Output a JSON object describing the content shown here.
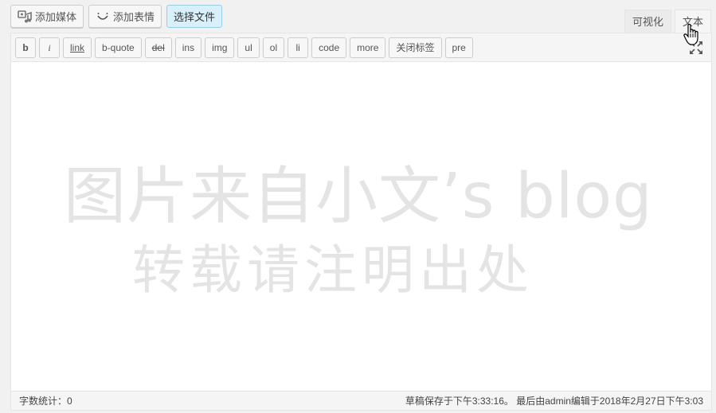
{
  "media_bar": {
    "add_media": "添加媒体",
    "add_emoji": "添加表情",
    "choose_file": "选择文件"
  },
  "tabs": [
    {
      "label": "可视化",
      "active": false
    },
    {
      "label": "文本",
      "active": true
    }
  ],
  "quicktags": [
    "b",
    "i",
    "link",
    "b-quote",
    "del",
    "ins",
    "img",
    "ul",
    "ol",
    "li",
    "code",
    "more",
    "关闭标签",
    "pre"
  ],
  "icons": {
    "add_media": "media-icon",
    "add_emoji": "smile-icon",
    "fullscreen": "fullscreen-icon",
    "cursor": "hand-cursor-icon"
  },
  "editor": {
    "content": "",
    "watermark_line1": "图片来自小文’s blog",
    "watermark_line2": "转载请注明出处"
  },
  "status": {
    "word_count": "字数统计：0",
    "draft_info": "草稿保存于下午3:33:16。 最后由admin编辑于2018年2月27日下午3:03"
  },
  "colors": {
    "choose_file_bg": "#d9f0fb",
    "border": "#cccccc",
    "watermark": "#e4e4e4"
  }
}
